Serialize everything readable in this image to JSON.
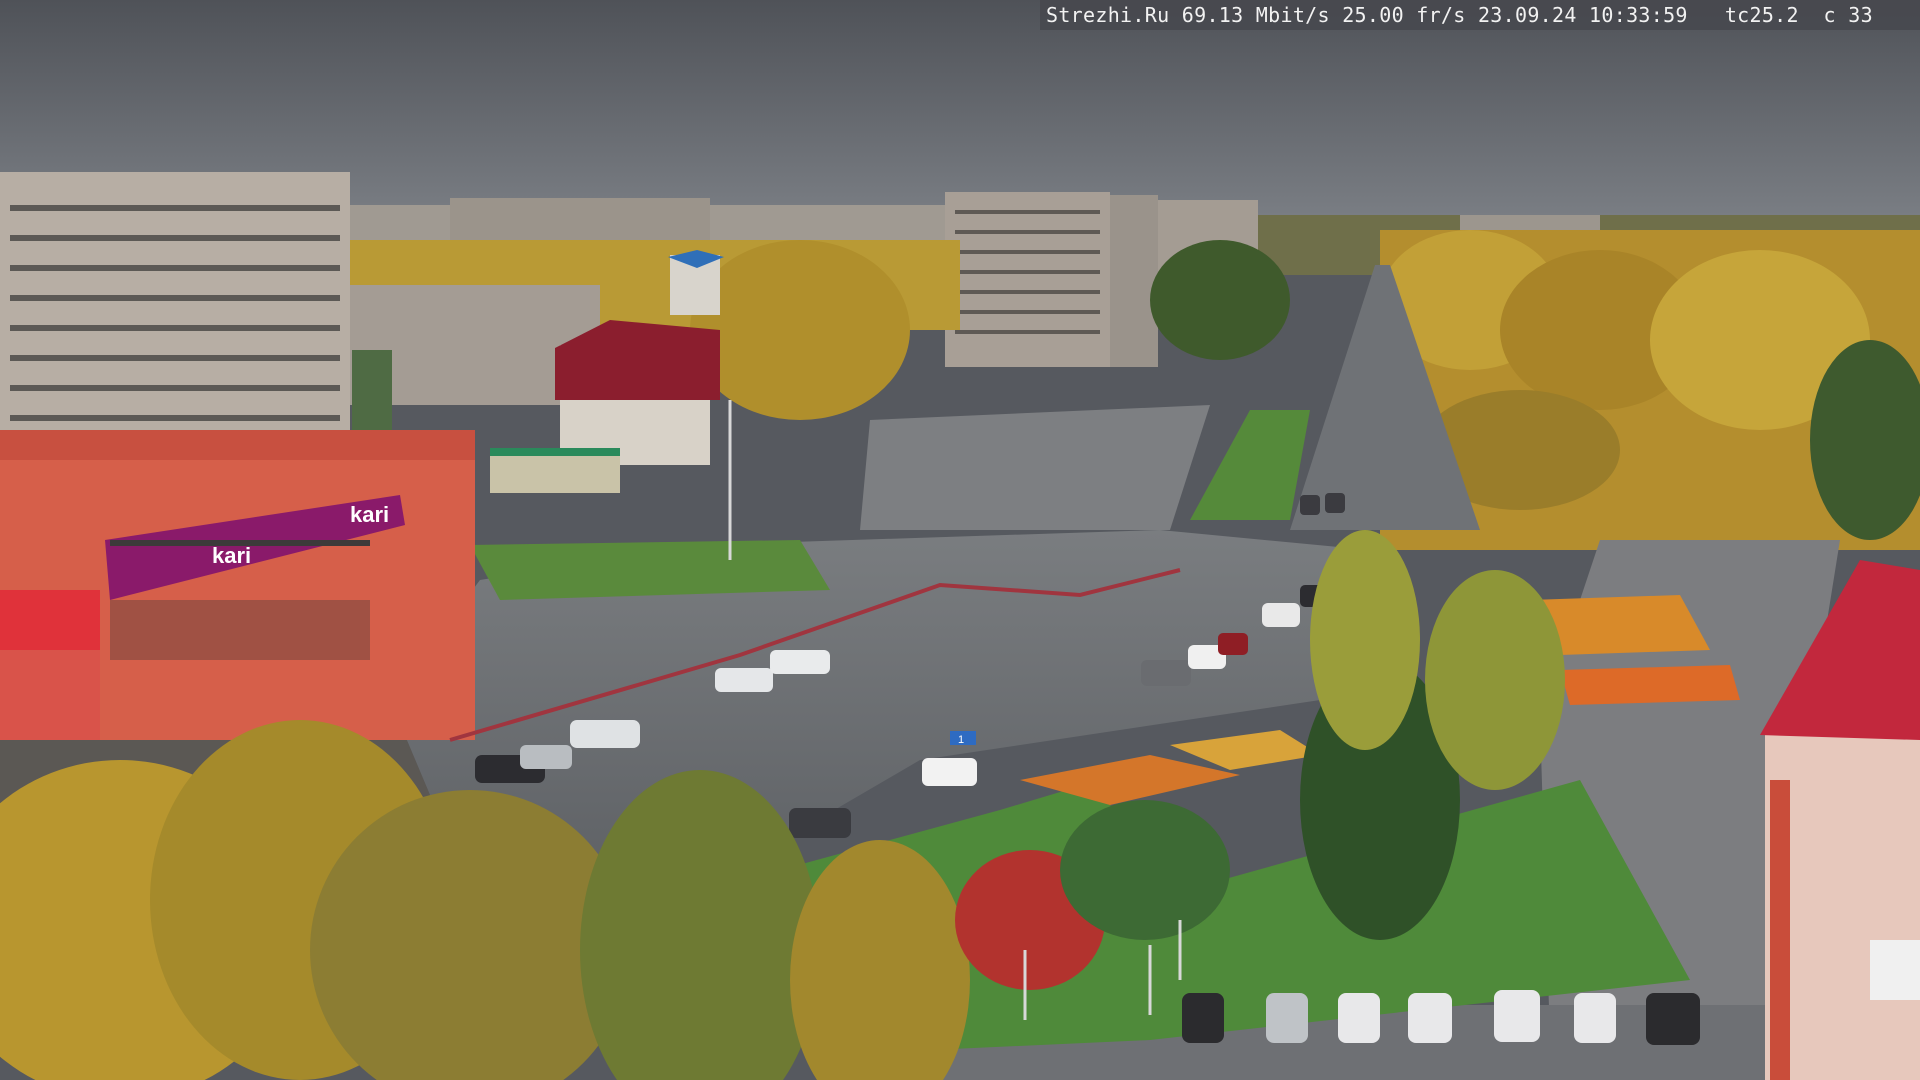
{
  "overlay": {
    "site": "Strezhi.Ru",
    "bitrate": "69.13 Mbit/s",
    "framerate": "25.00 fr/s",
    "date": "23.09.24",
    "time": "10:33:59",
    "code1": "tc25.2",
    "code2": "c 33"
  },
  "signs": {
    "kari_logo": "kari",
    "kari_sub": "kari",
    "shop_banner_left": "",
    "road_sign": "1"
  },
  "colors": {
    "sky": "#5b5e64",
    "kari_magenta": "#8a1a6a",
    "store_facade": "#d65f4a",
    "asphalt": "#6b6f73",
    "grass": "#4f8a3a",
    "autumn_yellow": "#c9a62e",
    "red_roof": "#c2283d"
  }
}
